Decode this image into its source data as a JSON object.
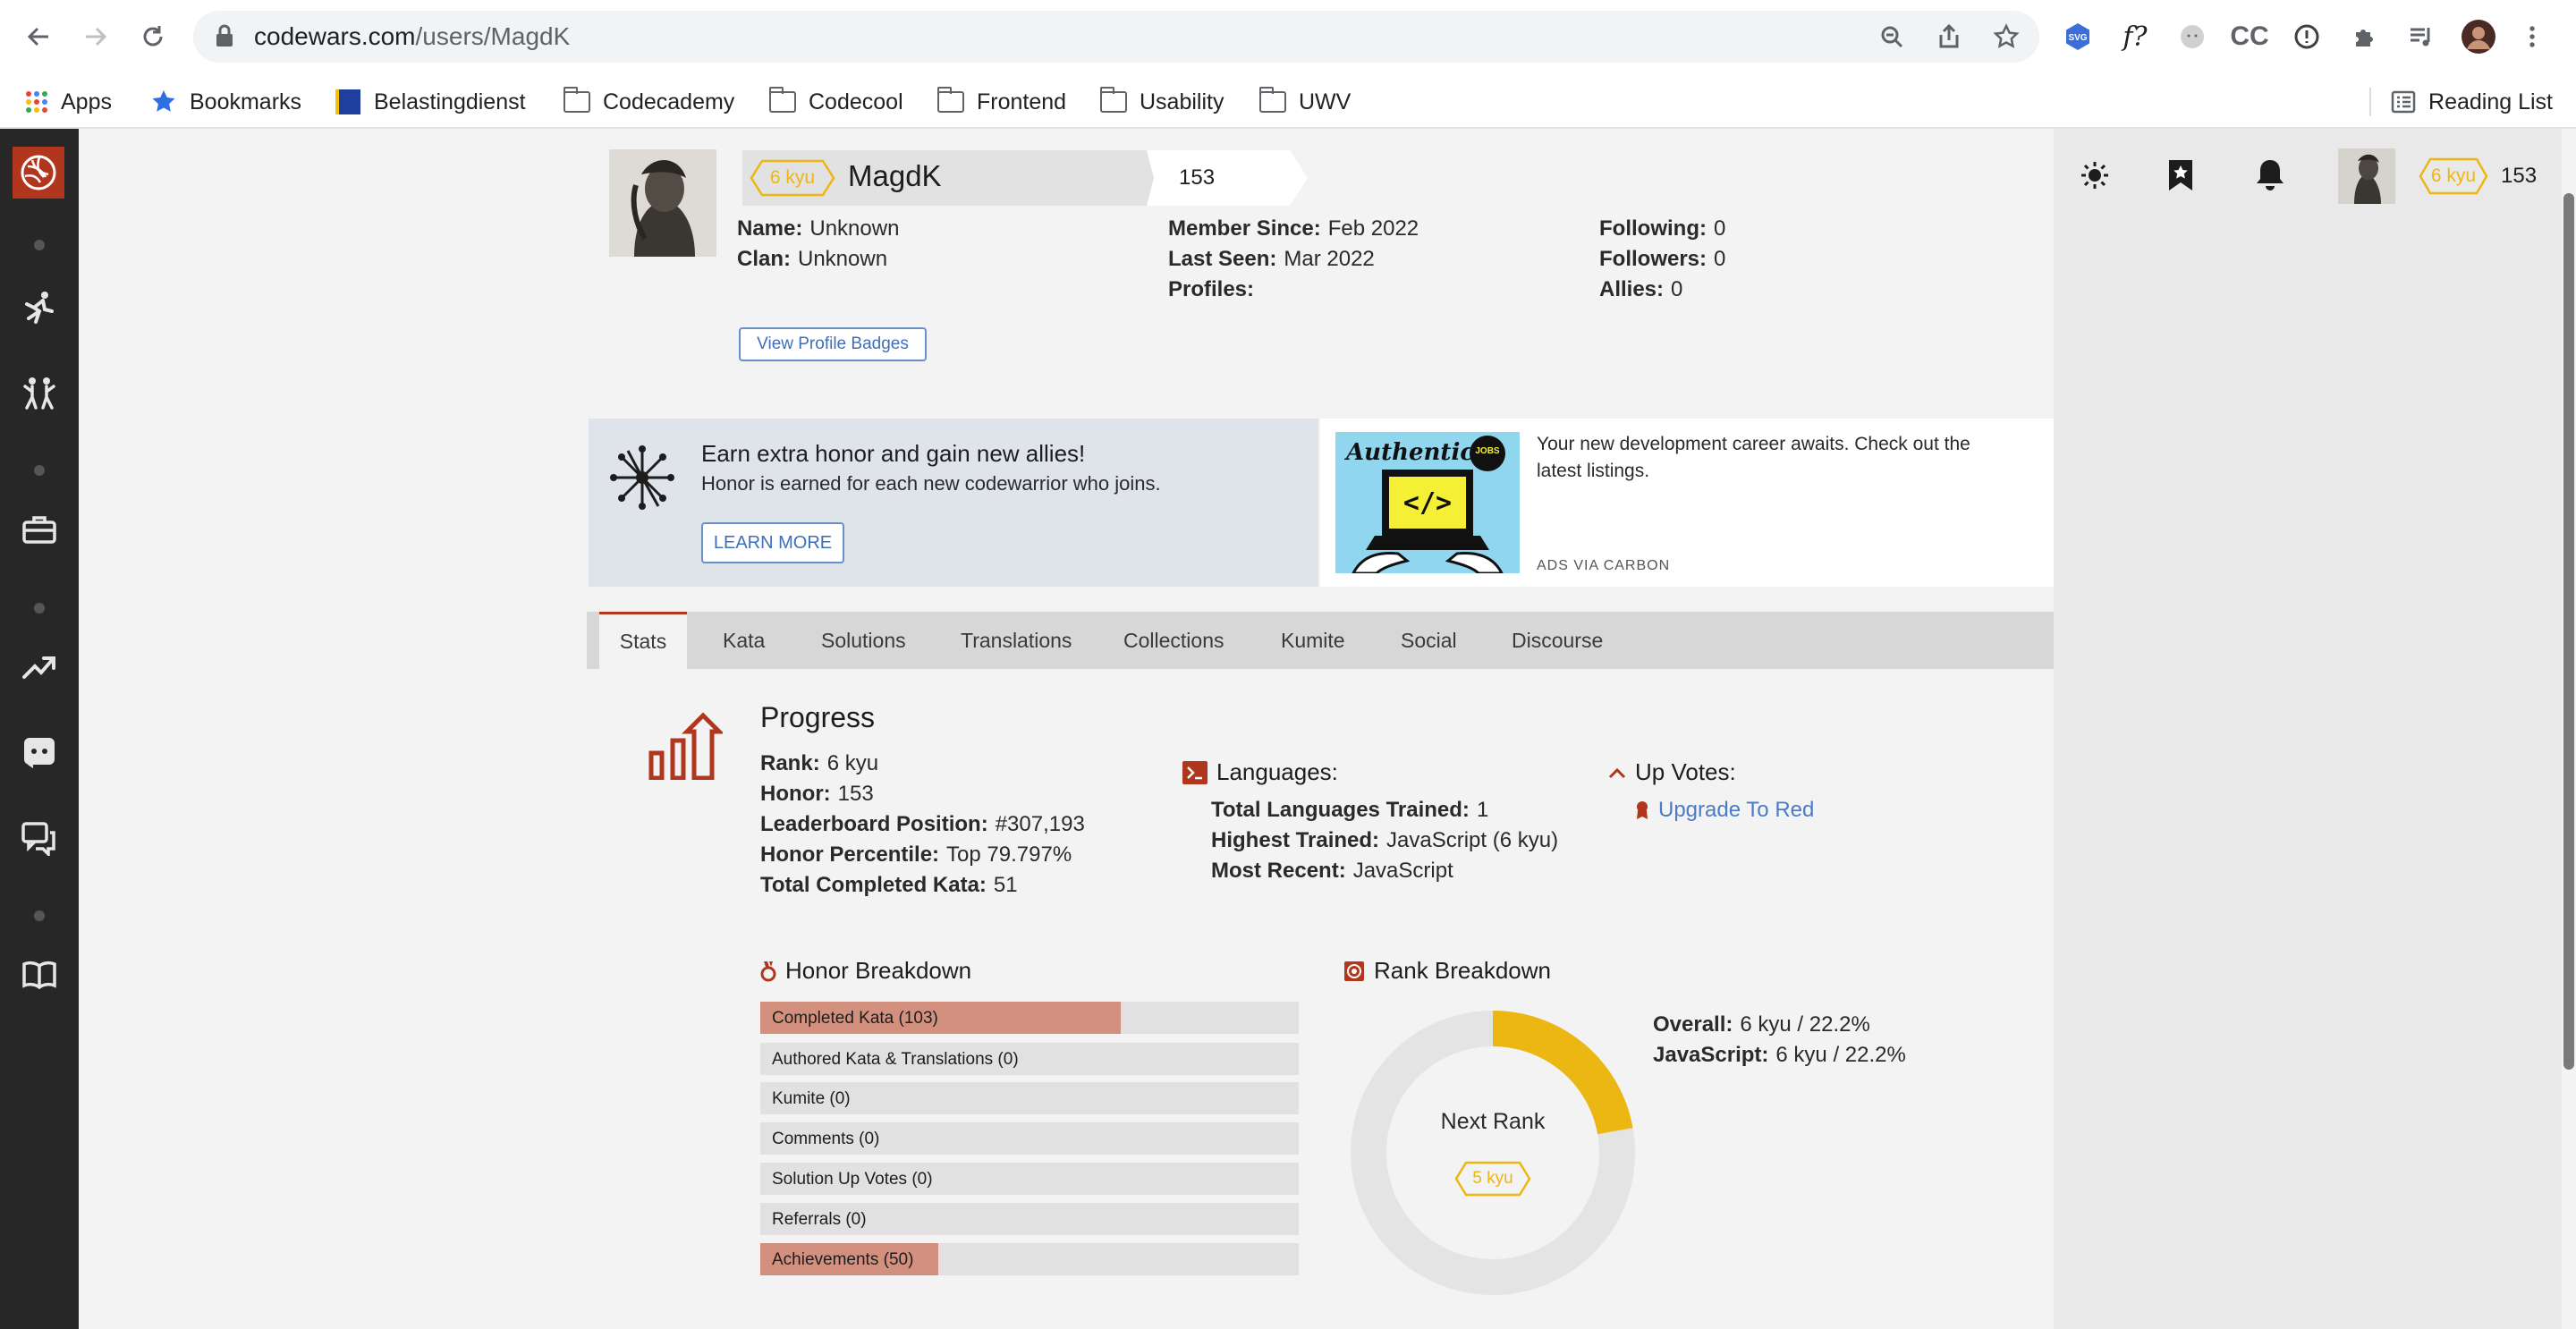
{
  "browser": {
    "url_host": "codewars.com",
    "url_path": "/users/MagdK",
    "bookmarks": [
      "Apps",
      "Bookmarks",
      "Belastingdienst",
      "Codecademy",
      "Codecool",
      "Frontend",
      "Usability",
      "UWV"
    ],
    "reading_list": "Reading List"
  },
  "topnav": {
    "rank": "6 kyu",
    "honor": "153"
  },
  "profile": {
    "rank": "6 kyu",
    "username": "MagdK",
    "honor": "153",
    "name_label": "Name:",
    "name_value": "Unknown",
    "clan_label": "Clan:",
    "clan_value": "Unknown",
    "member_since_label": "Member Since:",
    "member_since_value": "Feb 2022",
    "last_seen_label": "Last Seen:",
    "last_seen_value": "Mar 2022",
    "profiles_label": "Profiles:",
    "following_label": "Following:",
    "following_value": "0",
    "followers_label": "Followers:",
    "followers_value": "0",
    "allies_label": "Allies:",
    "allies_value": "0",
    "badges_button": "View Profile Badges"
  },
  "promo": {
    "title": "Earn extra honor and gain new allies!",
    "text": "Honor is earned for each new codewarrior who joins.",
    "button": "LEARN MORE"
  },
  "ad": {
    "brand": "Authentic",
    "badge": "JOBS",
    "code_glyph": "</>",
    "text_line1": "Your new development career awaits. Check out the",
    "text_line2": "latest listings.",
    "via": "ADS VIA CARBON"
  },
  "tabs": [
    "Stats",
    "Kata",
    "Solutions",
    "Translations",
    "Collections",
    "Kumite",
    "Social",
    "Discourse"
  ],
  "progress": {
    "title": "Progress",
    "rank_label": "Rank:",
    "rank_value": "6 kyu",
    "honor_label": "Honor:",
    "honor_value": "153",
    "leaderboard_label": "Leaderboard Position:",
    "leaderboard_value": "#307,193",
    "percentile_label": "Honor Percentile:",
    "percentile_value": "Top 79.797%",
    "completed_label": "Total Completed Kata:",
    "completed_value": "51"
  },
  "languages": {
    "title": "Languages:",
    "total_label": "Total Languages Trained:",
    "total_value": "1",
    "highest_label": "Highest Trained:",
    "highest_value": "JavaScript (6 kyu)",
    "recent_label": "Most Recent:",
    "recent_value": "JavaScript"
  },
  "upvotes": {
    "title": "Up Votes:",
    "link": "Upgrade To Red"
  },
  "honor_breakdown": {
    "title": "Honor Breakdown",
    "rows": [
      {
        "label": "Completed Kata (103)",
        "fill": 0.67
      },
      {
        "label": "Authored Kata & Translations (0)",
        "fill": 0
      },
      {
        "label": "Kumite (0)",
        "fill": 0
      },
      {
        "label": "Comments (0)",
        "fill": 0
      },
      {
        "label": "Solution Up Votes (0)",
        "fill": 0
      },
      {
        "label": "Referrals (0)",
        "fill": 0
      },
      {
        "label": "Achievements (50)",
        "fill": 0.33
      }
    ]
  },
  "rank_breakdown": {
    "title": "Rank Breakdown",
    "next_rank_label": "Next Rank",
    "next_rank": "5 kyu",
    "progress": 0.222,
    "overall_label": "Overall:",
    "overall_value": "6 kyu / 22.2%",
    "js_label": "JavaScript:",
    "js_value": "6 kyu / 22.2%"
  },
  "colors": {
    "accent_red": "#b1361e",
    "rank_yellow": "#ecb613",
    "bar_fill": "#d4907f",
    "link_blue": "#4a7bc4",
    "sidebar": "#272727"
  }
}
